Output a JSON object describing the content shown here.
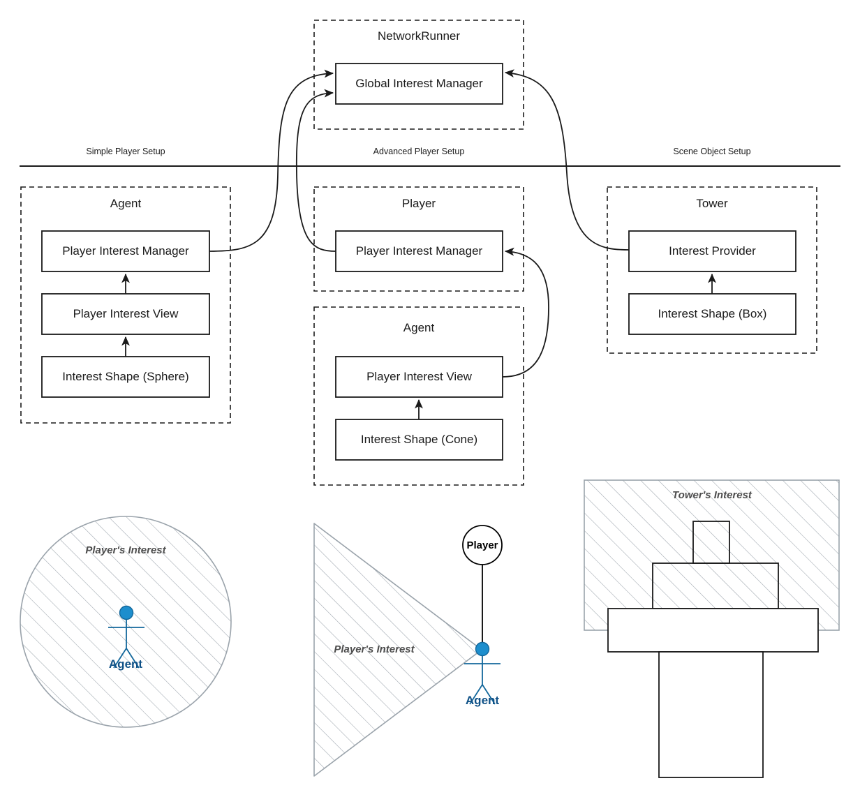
{
  "diagram": {
    "sections": [
      {
        "label": "Simple Player Setup"
      },
      {
        "label": "Advanced Player Setup"
      },
      {
        "label": "Scene Object Setup"
      }
    ],
    "groups": {
      "network_runner": {
        "title": "NetworkRunner"
      },
      "simple_agent": {
        "title": "Agent"
      },
      "advanced_player": {
        "title": "Player"
      },
      "advanced_agent": {
        "title": "Agent"
      },
      "tower": {
        "title": "Tower"
      }
    },
    "nodes": {
      "global_interest_manager": {
        "label": "Global Interest Manager"
      },
      "simple_player_interest_manager": {
        "label": "Player Interest Manager"
      },
      "simple_player_interest_view": {
        "label": "Player Interest View"
      },
      "simple_interest_shape": {
        "label": "Interest Shape (Sphere)"
      },
      "advanced_player_interest_manager": {
        "label": "Player Interest Manager"
      },
      "advanced_player_interest_view": {
        "label": "Player Interest View"
      },
      "advanced_interest_shape": {
        "label": "Interest Shape (Cone)"
      },
      "interest_provider": {
        "label": "Interest Provider"
      },
      "tower_interest_shape": {
        "label": "Interest Shape (Box)"
      }
    },
    "illustrations": {
      "sphere": {
        "area_label": "Player's Interest",
        "actor_label": "Agent"
      },
      "cone": {
        "area_label": "Player's Interest",
        "actor_label": "Agent",
        "owner_label": "Player"
      },
      "tower": {
        "area_label": "Tower's Interest"
      }
    },
    "colors": {
      "stroke": "#1a1a1a",
      "hatch": "#9aa3ab",
      "actor_head": "#1d8ecd",
      "actor_body": "#12679b",
      "actor_text": "#0f5187",
      "illus_text": "#4d4d4d"
    }
  }
}
